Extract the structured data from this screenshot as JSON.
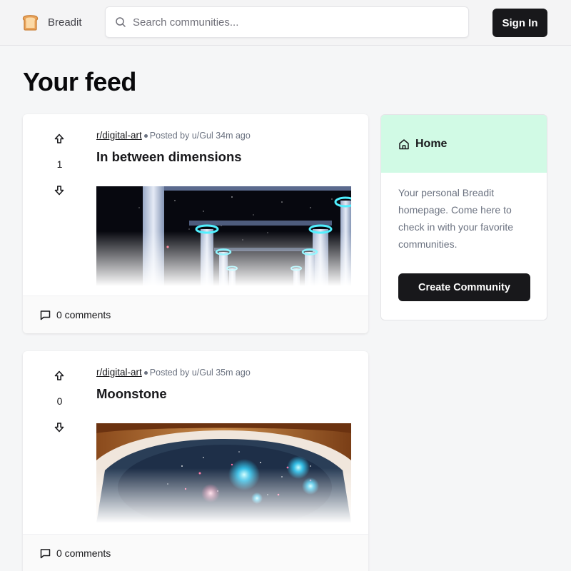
{
  "header": {
    "logo_text": "Breadit",
    "logo_icon": "bread-icon",
    "search_placeholder": "Search communities...",
    "search_value": "",
    "signin_label": "Sign In"
  },
  "feed": {
    "title": "Your feed",
    "posts": [
      {
        "subreddit": "r/digital-art",
        "posted_by": "Posted by u/Gul 34m ago",
        "title": "In between dimensions",
        "votes": "1",
        "comments": "0 comments",
        "image": "space-temple-columns"
      },
      {
        "subreddit": "r/digital-art",
        "posted_by": "Posted by u/Gul 35m ago",
        "title": "Moonstone",
        "votes": "0",
        "comments": "0 comments",
        "image": "galaxy-eye"
      }
    ]
  },
  "sidebar": {
    "title": "Home",
    "icon": "home-icon",
    "description": "Your personal Breadit homepage. Come here to check in with your favorite communities.",
    "create_label": "Create Community",
    "accent": "#d1fae5"
  }
}
